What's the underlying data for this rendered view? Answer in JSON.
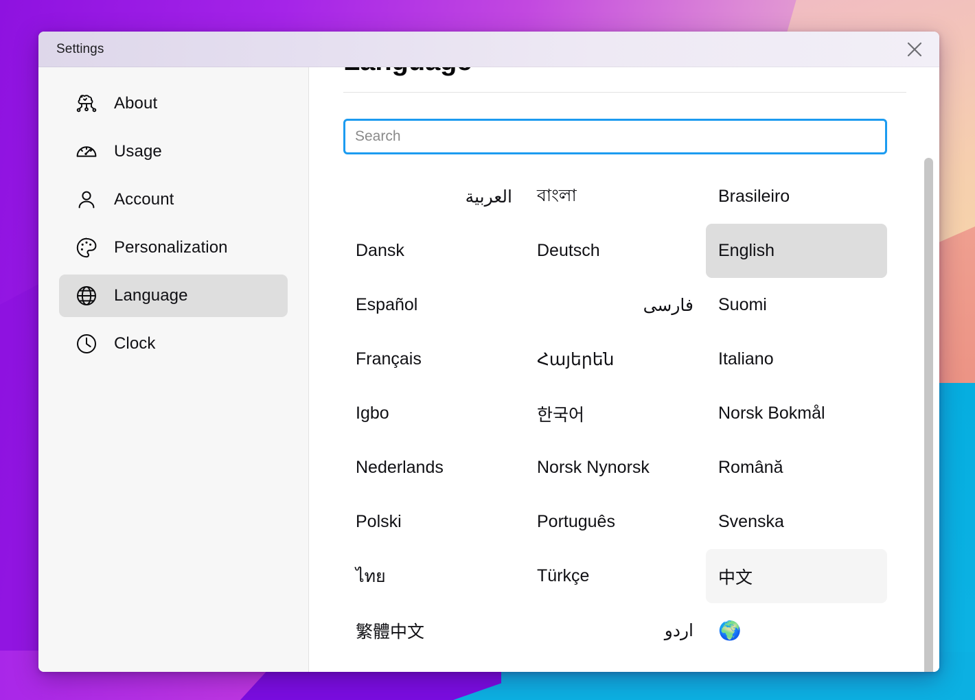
{
  "window": {
    "title": "Settings",
    "close_icon": "close-icon"
  },
  "sidebar": {
    "items": [
      {
        "label": "About",
        "icon": "brain-network-icon",
        "selected": false
      },
      {
        "label": "Usage",
        "icon": "gauge-icon",
        "selected": false
      },
      {
        "label": "Account",
        "icon": "person-icon",
        "selected": false
      },
      {
        "label": "Personalization",
        "icon": "palette-icon",
        "selected": false
      },
      {
        "label": "Language",
        "icon": "globe-icon",
        "selected": true
      },
      {
        "label": "Clock",
        "icon": "clock-icon",
        "selected": false
      }
    ]
  },
  "main": {
    "page_title": "Language",
    "search": {
      "value": "",
      "placeholder": "Search"
    },
    "languages": [
      {
        "label": "العربية",
        "state": "normal",
        "rtl": true
      },
      {
        "label": "বাংলা",
        "state": "normal",
        "rtl": false
      },
      {
        "label": "Brasileiro",
        "state": "normal",
        "rtl": false
      },
      {
        "label": "Dansk",
        "state": "normal",
        "rtl": false
      },
      {
        "label": "Deutsch",
        "state": "normal",
        "rtl": false
      },
      {
        "label": "English",
        "state": "current",
        "rtl": false
      },
      {
        "label": "Español",
        "state": "normal",
        "rtl": false
      },
      {
        "label": "فارسی",
        "state": "normal",
        "rtl": true
      },
      {
        "label": "Suomi",
        "state": "normal",
        "rtl": false
      },
      {
        "label": "Français",
        "state": "normal",
        "rtl": false
      },
      {
        "label": "Հայերեն",
        "state": "normal",
        "rtl": false
      },
      {
        "label": "Italiano",
        "state": "normal",
        "rtl": false
      },
      {
        "label": "Igbo",
        "state": "normal",
        "rtl": false
      },
      {
        "label": "한국어",
        "state": "normal",
        "rtl": false
      },
      {
        "label": "Norsk Bokmål",
        "state": "normal",
        "rtl": false
      },
      {
        "label": "Nederlands",
        "state": "normal",
        "rtl": false
      },
      {
        "label": "Norsk Nynorsk",
        "state": "normal",
        "rtl": false
      },
      {
        "label": "Română",
        "state": "normal",
        "rtl": false
      },
      {
        "label": "Polski",
        "state": "normal",
        "rtl": false
      },
      {
        "label": "Português",
        "state": "normal",
        "rtl": false
      },
      {
        "label": "Svenska",
        "state": "normal",
        "rtl": false
      },
      {
        "label": "ไทย",
        "state": "normal",
        "rtl": false
      },
      {
        "label": "Türkçe",
        "state": "normal",
        "rtl": false
      },
      {
        "label": "中文",
        "state": "hover",
        "rtl": false
      },
      {
        "label": "繁體中文",
        "state": "normal",
        "rtl": false
      },
      {
        "label": "اردو",
        "state": "normal",
        "rtl": true
      },
      {
        "label": "🌍",
        "state": "emoji",
        "rtl": false
      }
    ]
  },
  "scrollbar": {
    "orientation": "vertical"
  },
  "cursor": {
    "type": "pointing-hand"
  },
  "colors": {
    "accent_focus": "#1c9bf0",
    "selected_bg": "#dedede",
    "hover_bg": "#f5f5f5",
    "sidebar_bg": "#f7f7f7",
    "titlebar_gradient_start": "#ded7ea",
    "titlebar_gradient_end": "#f2eff7"
  }
}
